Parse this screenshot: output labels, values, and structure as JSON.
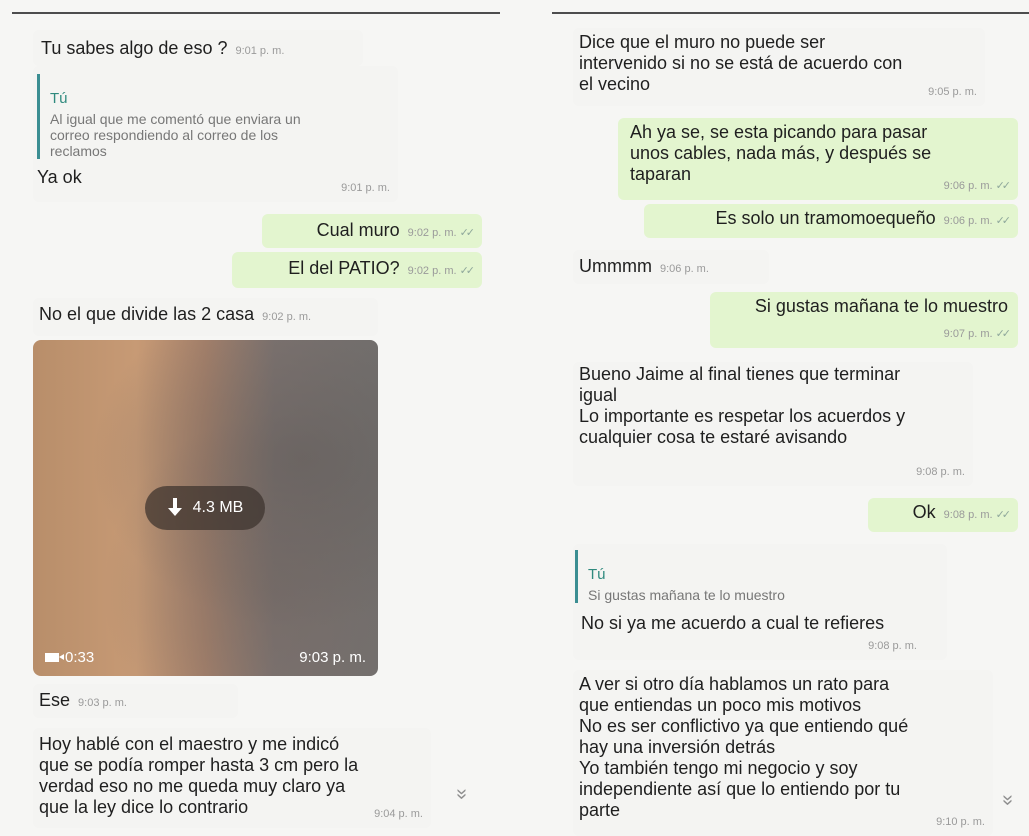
{
  "left": {
    "m1": {
      "text": "Tu sabes algo de eso ?",
      "time": "9:01 p. m."
    },
    "m2": {
      "quote_author": "Tú",
      "quote_text": "Al igual que me comentó que enviara un\ncorreo respondiendo al correo de los\nreclamos",
      "text": "Ya ok",
      "time": "9:01 p. m."
    },
    "m3": {
      "text": "Cual muro",
      "time": "9:02 p. m."
    },
    "m4": {
      "text": "El del PATIO?",
      "time": "9:02 p. m."
    },
    "m5": {
      "text": "No el que divide las 2 casa",
      "time": "9:02 p. m."
    },
    "video": {
      "size": "4.3 MB",
      "duration": "0:33",
      "time": "9:03 p. m.",
      "download_icon": "download-icon",
      "camera_icon": "video-camera-icon"
    },
    "m6": {
      "text": "Ese",
      "time": "9:03 p. m."
    },
    "m7": {
      "text": "Hoy hablé con el maestro y me indicó\nque se podía romper hasta 3 cm pero la\nverdad eso no me queda muy claro ya\nque la ley dice lo contrario",
      "time": "9:04 p. m."
    }
  },
  "right": {
    "m1": {
      "text": "Dice que el muro no puede ser\nintervenido si no se está de acuerdo con\nel vecino",
      "time": "9:05 p. m."
    },
    "m2": {
      "text": "Ah ya se, se esta picando para pasar\nunos cables, nada más, y después se\ntaparan",
      "time": "9:06 p. m."
    },
    "m3": {
      "text": "Es solo un tramomoequeño",
      "time": "9:06 p. m."
    },
    "m4": {
      "text": "Ummmm",
      "time": "9:06 p. m."
    },
    "m5": {
      "text": "Si gustas mañana te lo muestro",
      "time": "9:07 p. m."
    },
    "m6": {
      "text": "Bueno Jaime al final tienes que terminar\nigual\nLo importante es respetar los acuerdos y\ncualquier cosa te estaré avisando",
      "time": "9:08 p. m."
    },
    "m7": {
      "text": "Ok",
      "time": "9:08 p. m."
    },
    "m8": {
      "quote_author": "Tú",
      "quote_text": "Si gustas mañana te lo muestro",
      "text": "No si ya me acuerdo a cual te refieres",
      "time": "9:08 p. m."
    },
    "m9": {
      "text": "A ver si otro día hablamos un rato para\nque entiendas un poco mis motivos\nNo es ser conflictivo ya que entiendo qué\nhay una inversión detrás\nYo también tengo mi negocio y soy\nindependiente así que lo entiendo por tu\nparte",
      "time": "9:10 p. m."
    }
  },
  "icons": {
    "read_ticks": "✓✓",
    "scroll_down": "»"
  },
  "colors": {
    "incoming": "#f4f4f2",
    "outgoing": "#e3f5cf",
    "quote_bar": "#3b8e92",
    "quote_author": "#2f8a7e",
    "timestamp": "#9a9a9a"
  }
}
